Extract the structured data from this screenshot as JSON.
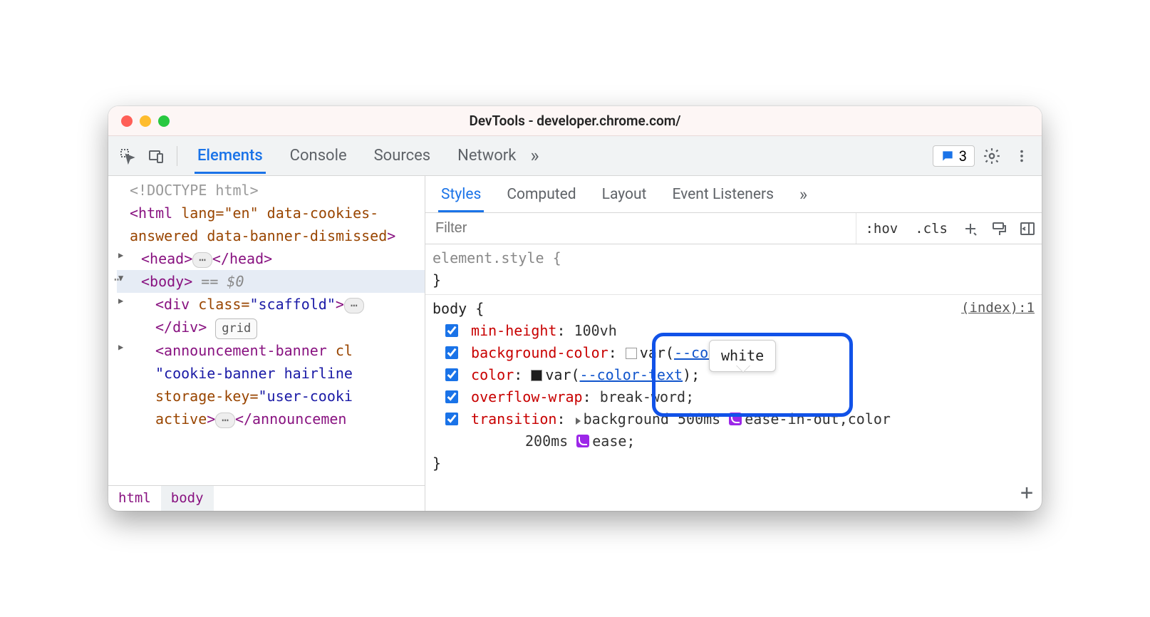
{
  "window_title": "DevTools - developer.chrome.com/",
  "toolbar": {
    "tabs": [
      "Elements",
      "Console",
      "Sources",
      "Network"
    ],
    "active_tab": "Elements",
    "overflow_glyph": "»",
    "issues_count": "3"
  },
  "dom": {
    "doctype": "<!DOCTYPE html>",
    "html_open": {
      "tag": "<html",
      "attrs": " lang=\"en\" data-cookies-answered data-banner-dismissed",
      "close": ">"
    },
    "head": {
      "open": "<head>",
      "close": "</head>",
      "ellipsis": "⋯"
    },
    "body": {
      "open": "<body>",
      "eq0": "== $0"
    },
    "div_scaffold": {
      "open": "<div class=\"scaffold\">",
      "close": "</div>",
      "grid_chip": "grid"
    },
    "announcement": {
      "text_open": "<announcement-banner cl",
      "text_mid": "\"cookie-banner hairline",
      "text_key": "storage-key=\"user-cooki",
      "text_active": "active>",
      "close": "</announcemen",
      "ellipsis": "⋯"
    }
  },
  "breadcrumbs": [
    "html",
    "body"
  ],
  "subtabs": {
    "items": [
      "Styles",
      "Computed",
      "Layout",
      "Event Listeners"
    ],
    "active": "Styles",
    "overflow": "»"
  },
  "filter": {
    "placeholder": "Filter",
    "hov": ":hov",
    "cls": ".cls"
  },
  "rules": {
    "element_style": "element.style {",
    "element_style_close": "}",
    "body_selector": "body {",
    "source_link": "(index):1",
    "decls": [
      {
        "prop": "min-height",
        "value": "100vh",
        "var": null
      },
      {
        "prop": "background-color",
        "value_prefix": "",
        "swatch": "white",
        "var": "--color-bg",
        "suffix": ")"
      },
      {
        "prop": "color",
        "value_prefix": "",
        "swatch": "black",
        "var": "--color-text",
        "suffix": ");"
      },
      {
        "prop": "overflow-wrap",
        "value": "break-word;",
        "var": null
      },
      {
        "prop": "transition",
        "value": "background 500ms",
        "cubic1": "ease-in-out",
        "after1": ",color",
        "line2": "200ms",
        "cubic2": "ease;"
      }
    ],
    "body_close": "}"
  },
  "tooltip": {
    "text": "white"
  }
}
